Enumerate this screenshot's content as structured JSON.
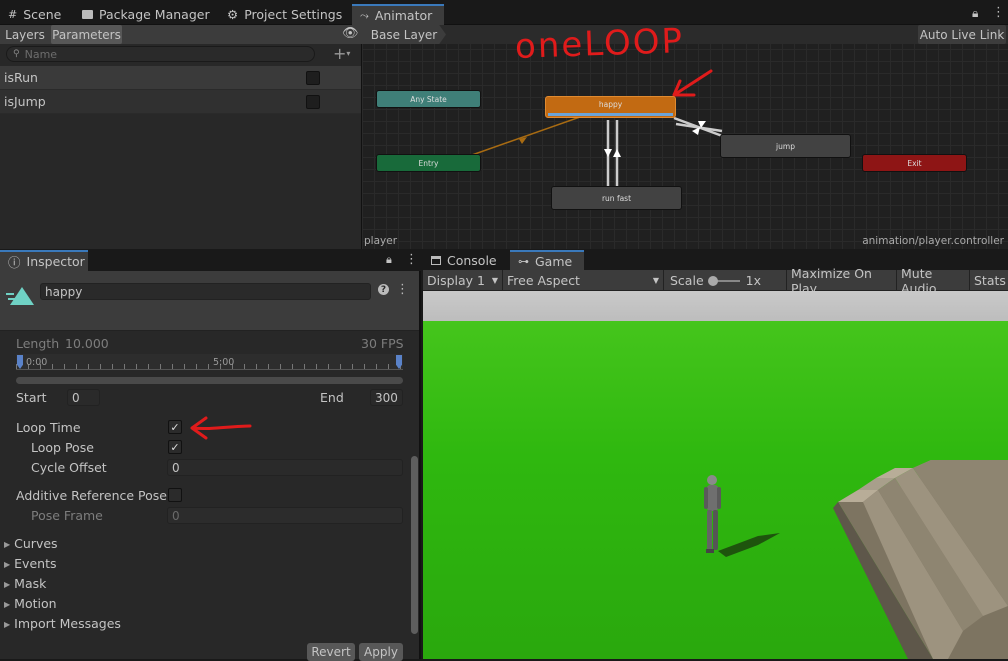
{
  "tabs": [
    {
      "label": "Scene",
      "icon": "grid-icon"
    },
    {
      "label": "Package Manager",
      "icon": "package-icon"
    },
    {
      "label": "Project Settings",
      "icon": "gear-icon"
    },
    {
      "label": "Animator",
      "icon": "animator-icon"
    }
  ],
  "params": {
    "tab_layers": "Layers",
    "tab_parameters": "Parameters",
    "search_placeholder": "Name",
    "items": [
      {
        "name": "isRun",
        "checked": false
      },
      {
        "name": "isJump",
        "checked": false
      }
    ]
  },
  "graph": {
    "breadcrumb": "Base Layer",
    "auto_live_link": "Auto Live Link",
    "nodes": {
      "any_state": "Any State",
      "happy": "happy",
      "entry": "Entry",
      "jump": "jump",
      "exit": "Exit",
      "run_fast": "run fast"
    },
    "annotation": "oneLOOP",
    "footer_left": "player",
    "footer_right": "animation/player.controller"
  },
  "inspector": {
    "tab": "Inspector",
    "clip_name": "happy",
    "length_label": "Length",
    "length_value": "10.000",
    "fps": "30 FPS",
    "tick_start": "0:00",
    "tick_mid": "5:00",
    "start_label": "Start",
    "start_value": "0",
    "end_label": "End",
    "end_value": "300",
    "loop_time_label": "Loop Time",
    "loop_time": true,
    "loop_pose_label": "Loop Pose",
    "loop_pose": true,
    "cycle_offset_label": "Cycle Offset",
    "cycle_offset": "0",
    "additive_label": "Additive Reference Pose",
    "additive": false,
    "pose_frame_label": "Pose Frame",
    "pose_frame": "0",
    "foldouts": [
      "Curves",
      "Events",
      "Mask",
      "Motion",
      "Import Messages"
    ],
    "revert": "Revert",
    "apply": "Apply"
  },
  "game": {
    "tab_console": "Console",
    "tab_game": "Game",
    "display": "Display 1",
    "aspect": "Free Aspect",
    "scale_label": "Scale",
    "scale_value": "1x",
    "maximize": "Maximize On Play",
    "mute": "Mute Audio",
    "stats": "Stats"
  },
  "colors": {
    "accent": "#3a79bb",
    "any_state": "#3f7f78",
    "happy": "#c26a12",
    "entry": "#186a3a",
    "exit": "#8e1515",
    "ground": "#2fb80f",
    "sky": "#c8c8c8",
    "annotation": "#e01b1b"
  }
}
